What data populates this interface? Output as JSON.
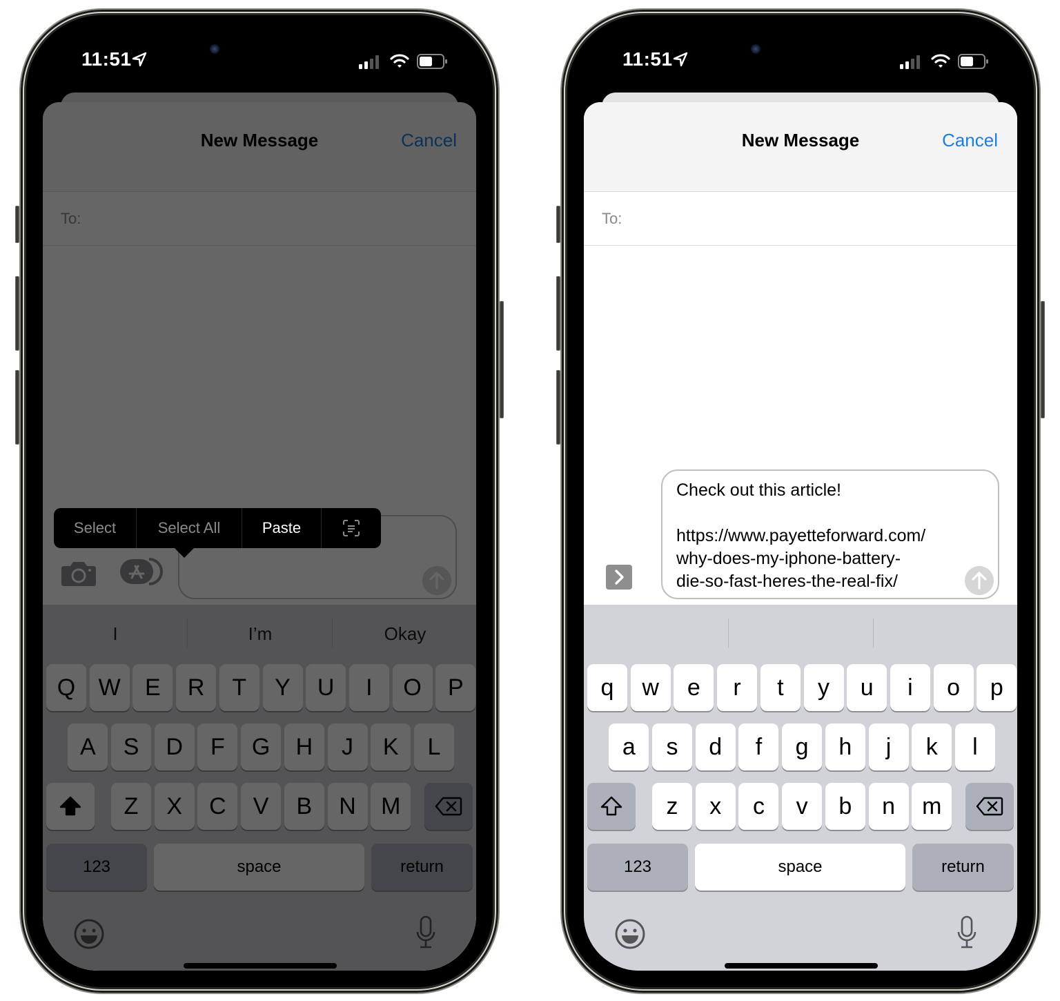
{
  "left_phone": {
    "status": {
      "time": "11:51"
    },
    "header": {
      "title": "New Message",
      "cancel_label": "Cancel"
    },
    "to_field": {
      "label": "To:",
      "value": ""
    },
    "message_field": {
      "value": ""
    },
    "edit_menu": {
      "items": [
        {
          "label": "Select",
          "active": false
        },
        {
          "label": "Select All",
          "active": false
        },
        {
          "label": "Paste",
          "active": true
        },
        {
          "label": "",
          "icon": "scan-text-icon",
          "active": false
        }
      ]
    },
    "predictions": [
      "I",
      "I’m",
      "Okay"
    ],
    "keyboard": {
      "row1": [
        "Q",
        "W",
        "E",
        "R",
        "T",
        "Y",
        "U",
        "I",
        "O",
        "P"
      ],
      "row2": [
        "A",
        "S",
        "D",
        "F",
        "G",
        "H",
        "J",
        "K",
        "L"
      ],
      "row3": [
        "Z",
        "X",
        "C",
        "V",
        "B",
        "N",
        "M"
      ],
      "numbers_label": "123",
      "space_label": "space",
      "return_label": "return",
      "shift_state": "on"
    }
  },
  "right_phone": {
    "status": {
      "time": "11:51"
    },
    "header": {
      "title": "New Message",
      "cancel_label": "Cancel"
    },
    "to_field": {
      "label": "To:",
      "value": ""
    },
    "message_field": {
      "value": "Check out this article!\n\nhttps://www.payetteforward.com/\nwhy-does-my-iphone-battery-\ndie-so-fast-heres-the-real-fix/"
    },
    "predictions": [
      "",
      "",
      ""
    ],
    "keyboard": {
      "row1": [
        "q",
        "w",
        "e",
        "r",
        "t",
        "y",
        "u",
        "i",
        "o",
        "p"
      ],
      "row2": [
        "a",
        "s",
        "d",
        "f",
        "g",
        "h",
        "j",
        "k",
        "l"
      ],
      "row3": [
        "z",
        "x",
        "c",
        "v",
        "b",
        "n",
        "m"
      ],
      "numbers_label": "123",
      "space_label": "space",
      "return_label": "return",
      "shift_state": "off"
    }
  },
  "colors": {
    "accent": "#1b7ee0",
    "keyboard_bg": "#d1d3d9",
    "key_bg": "#ffffff",
    "func_key_bg": "#abb0bb"
  }
}
